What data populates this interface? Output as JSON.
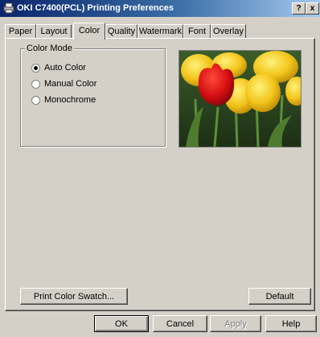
{
  "window": {
    "title": "OKI C7400(PCL) Printing Preferences",
    "help_btn": "?",
    "close_btn": "x"
  },
  "tabs": [
    {
      "label": "Paper"
    },
    {
      "label": "Layout"
    },
    {
      "label": "Color",
      "active": true
    },
    {
      "label": "Quality"
    },
    {
      "label": "Watermark"
    },
    {
      "label": "Font"
    },
    {
      "label": "Overlay"
    }
  ],
  "color_mode": {
    "legend": "Color Mode",
    "options": [
      {
        "label": "Auto Color",
        "selected": true
      },
      {
        "label": "Manual Color",
        "selected": false
      },
      {
        "label": "Monochrome",
        "selected": false
      }
    ]
  },
  "panel_buttons": {
    "swatch": "Print Color Swatch...",
    "default": "Default"
  },
  "dialog_buttons": {
    "ok": "OK",
    "cancel": "Cancel",
    "apply": "Apply",
    "help": "Help"
  },
  "colors": {
    "titlebar_start": "#0a246a",
    "titlebar_end": "#a6caf0",
    "face": "#d4d0c8"
  },
  "icons": {
    "title": "printer-icon"
  }
}
